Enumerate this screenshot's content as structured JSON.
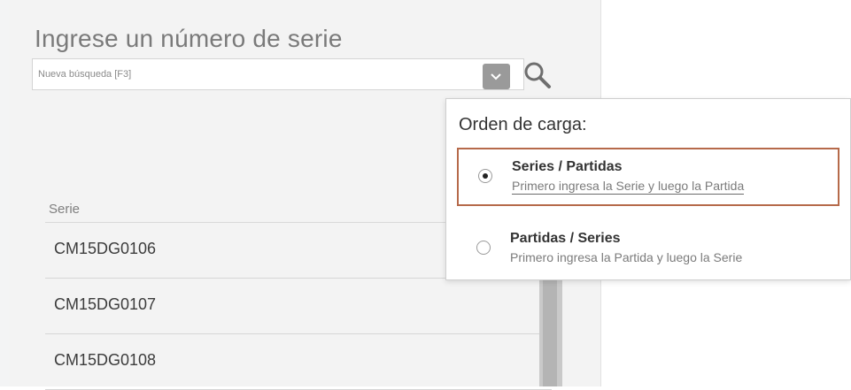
{
  "search": {
    "title": "Ingrese un número de serie",
    "placeholder": "Nueva búsqueda [F3]"
  },
  "table": {
    "header": "Serie",
    "rows": [
      "CM15DG0106",
      "CM15DG0107",
      "CM15DG0108"
    ]
  },
  "load_order": {
    "title": "Orden de carga:",
    "options": [
      {
        "label": "Series / Partidas",
        "description": "Primero ingresa la Serie y luego la Partida",
        "selected": true
      },
      {
        "label": "Partidas / Series",
        "description": "Primero ingresa la Partida y luego la Serie",
        "selected": false
      }
    ]
  },
  "colors": {
    "panel_bg": "#f3f3f3",
    "selected_border": "#b66a4a",
    "dropdown_button": "#9a9a9a"
  },
  "icons": [
    "chevron-down-icon",
    "search-icon",
    "radio-icon"
  ]
}
